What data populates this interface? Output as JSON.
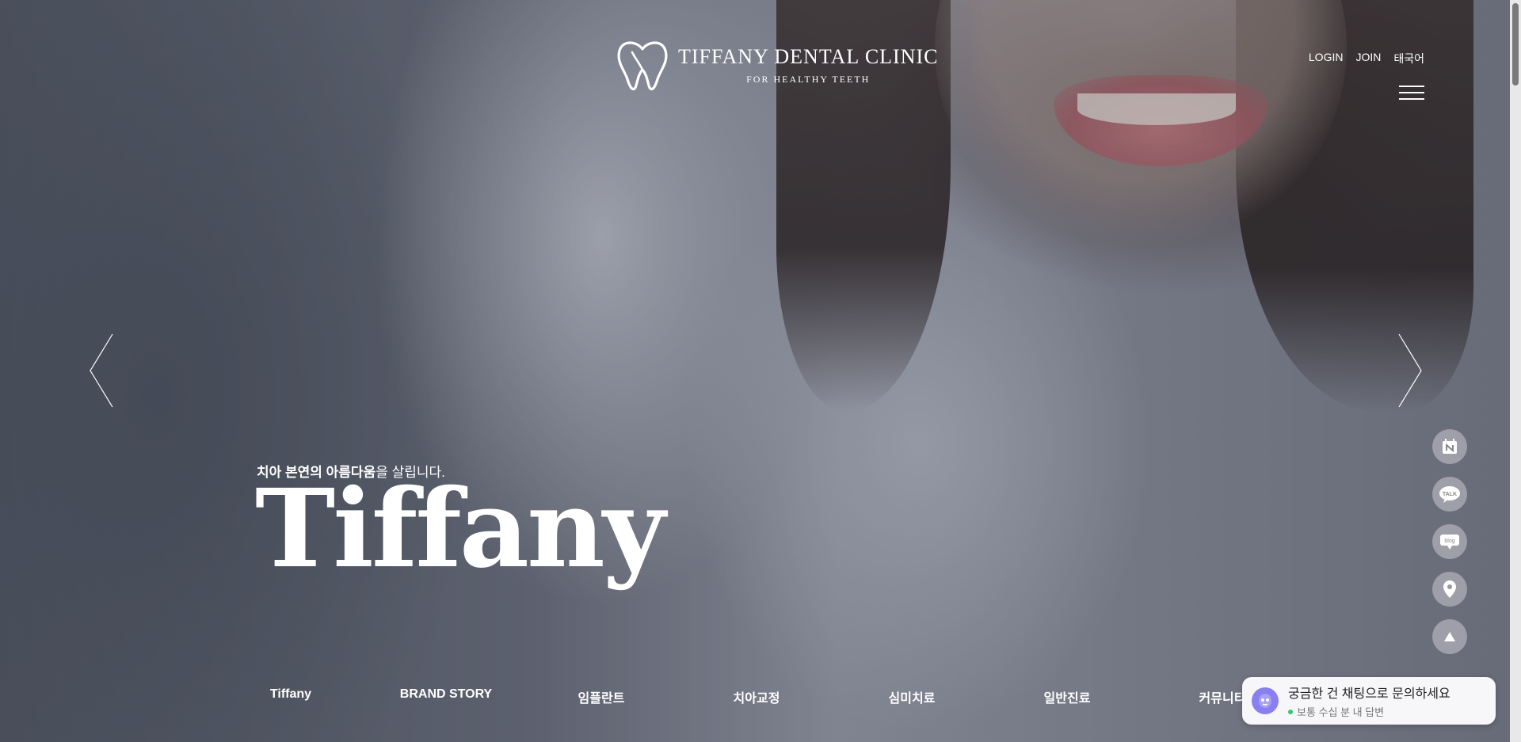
{
  "brand": {
    "title": "TIFFANY DENTAL CLINIC",
    "subtitle": "FOR HEALTHY TEETH"
  },
  "header": {
    "links": [
      "LOGIN",
      "JOIN",
      "태국어"
    ]
  },
  "hero": {
    "tagline_bold": "치아 본연의 아름다움",
    "tagline_rest": "을 살립니다.",
    "title": "Tiffany"
  },
  "nav": {
    "items": [
      "Tiffany",
      "BRAND STORY",
      "임플란트",
      "치아교정",
      "심미치료",
      "일반진료",
      "커뮤니티"
    ]
  },
  "quick_menu": {
    "items": [
      {
        "icon": "calendar-n-icon"
      },
      {
        "icon": "kakao-talk-icon",
        "label": "TALK"
      },
      {
        "icon": "blog-icon",
        "label": "blog"
      },
      {
        "icon": "location-pin-icon"
      },
      {
        "icon": "scroll-top-icon"
      }
    ]
  },
  "chat": {
    "message": "궁금한 건 채팅으로 문의하세요",
    "status": "보통 수십 분 내 답변"
  }
}
